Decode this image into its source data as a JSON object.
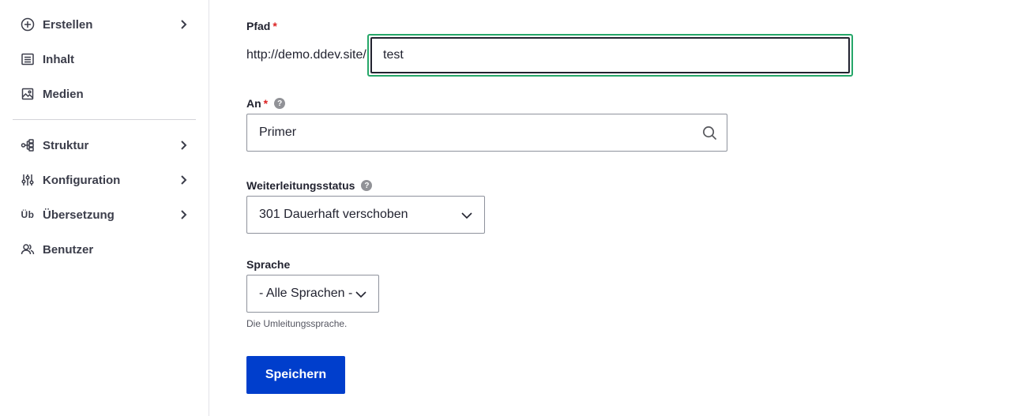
{
  "sidebar": {
    "items": [
      {
        "label": "Erstellen",
        "icon": "plus-circle-icon",
        "has_submenu": true
      },
      {
        "label": "Inhalt",
        "icon": "content-list-icon",
        "has_submenu": false
      },
      {
        "label": "Medien",
        "icon": "media-image-icon",
        "has_submenu": false
      },
      {
        "label": "Struktur",
        "icon": "structure-icon",
        "has_submenu": true
      },
      {
        "label": "Konfiguration",
        "icon": "sliders-icon",
        "has_submenu": true
      },
      {
        "label": "Übersetzung",
        "icon_text": "Üb",
        "has_submenu": true
      },
      {
        "label": "Benutzer",
        "icon": "users-icon",
        "has_submenu": false
      }
    ]
  },
  "form": {
    "path": {
      "label": "Pfad",
      "required_mark": "*",
      "prefix": "http://demo.ddev.site/",
      "value": "test"
    },
    "to": {
      "label": "An",
      "required_mark": "*",
      "help": "?",
      "value": "Primer"
    },
    "status": {
      "label": "Weiterleitungsstatus",
      "help": "?",
      "selected": "301 Dauerhaft verschoben"
    },
    "language": {
      "label": "Sprache",
      "selected": "- Alle Sprachen -",
      "description": "Die Umleitungssprache."
    },
    "save_label": "Speichern"
  },
  "colors": {
    "focus_ring": "#26a769",
    "primary_button": "#003ecc",
    "required": "#dc2323"
  }
}
